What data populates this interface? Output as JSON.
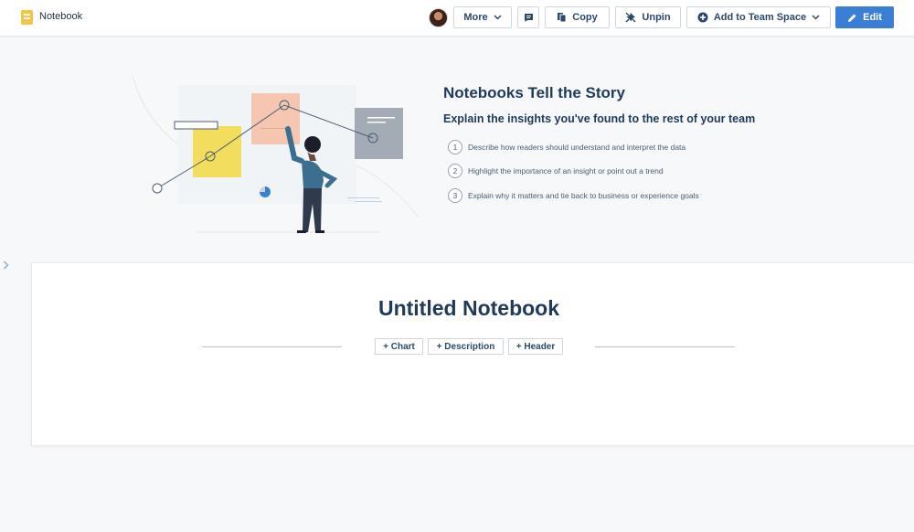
{
  "header": {
    "app_title": "Notebook",
    "buttons": {
      "more": "More",
      "copy": "Copy",
      "unpin": "Unpin",
      "add_to_team_space": "Add to Team Space",
      "edit": "Edit"
    }
  },
  "hero": {
    "title": "Notebooks Tell the Story",
    "subtitle": "Explain the insights you've found to the rest of your team",
    "steps": [
      {
        "num": "1",
        "text": "Describe how readers should understand and interpret the data"
      },
      {
        "num": "2",
        "text": "Highlight the importance of an insight or point out a trend"
      },
      {
        "num": "3",
        "text": "Explain why it matters and tie back to business or experience goals"
      }
    ]
  },
  "notebook": {
    "title": "Untitled Notebook",
    "add_buttons": {
      "chart": "+ Chart",
      "description": "+ Description",
      "header": "+ Header"
    }
  },
  "icons": {
    "app": "notebook-icon",
    "more": "chevron-down-icon",
    "comment": "comment-icon",
    "copy": "copy-icon",
    "unpin": "unpin-icon",
    "team": "plus-circle-icon",
    "edit": "pencil-icon",
    "sidebar": "chevron-right-icon"
  },
  "colors": {
    "accent": "#3a7fd5",
    "text": "#1f3a5a",
    "sticky_yellow": "#f3dd5d",
    "sticky_peach": "#f6c7b0",
    "sticky_gray": "#a3abb5"
  }
}
